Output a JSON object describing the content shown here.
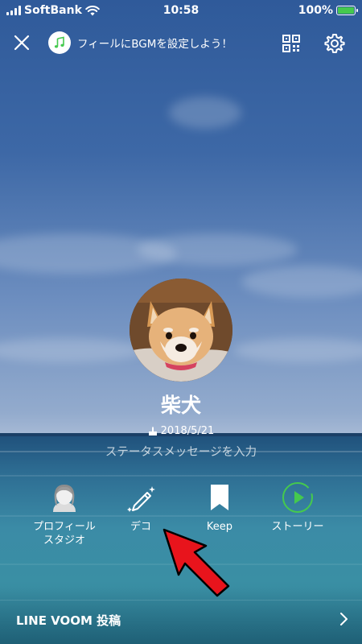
{
  "status_bar": {
    "carrier": "SoftBank",
    "time": "10:58",
    "battery": "100%"
  },
  "top_bar": {
    "bgm_text": "フィールにBGMを設定しよう！"
  },
  "profile": {
    "name": "柴犬",
    "birthday": "2018/5/21",
    "status_placeholder": "ステータスメッセージを入力"
  },
  "actions": [
    {
      "label": "プロフィール\nスタジオ",
      "icon": "avatar-icon"
    },
    {
      "label": "デコ",
      "icon": "pen-sparkle-icon"
    },
    {
      "label": "Keep",
      "icon": "bookmark-icon"
    },
    {
      "label": "ストーリー",
      "icon": "story-play-icon"
    }
  ],
  "footer": {
    "label": "LINE VOOM 投稿"
  },
  "colors": {
    "accent_green": "#45c94e",
    "arrow_red": "#e8141c"
  }
}
